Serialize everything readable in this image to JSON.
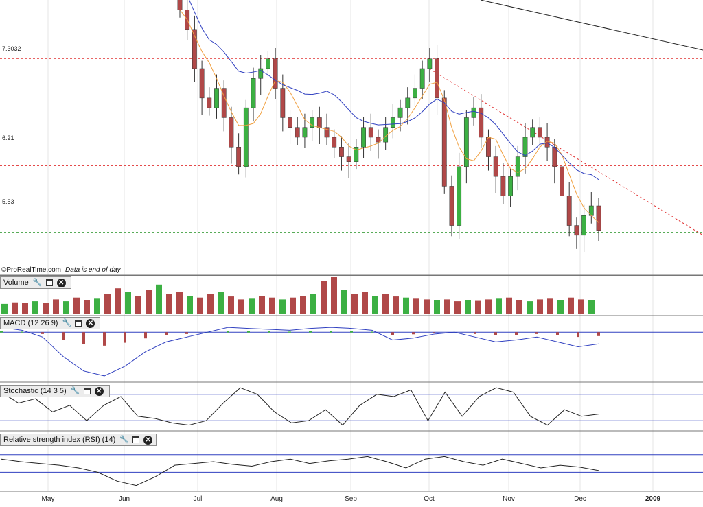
{
  "watermark": {
    "brand": "©ProRealTime.com",
    "note": "Data is end of day"
  },
  "panels": {
    "volume": {
      "label": "Volume"
    },
    "macd": {
      "label": "MACD (12 26 9)"
    },
    "stochastic": {
      "label": "Stochastic (14 3 5)"
    },
    "rsi": {
      "label": "Relative strength index (RSI) (14)"
    }
  },
  "price_levels": [
    {
      "label": "7.3032",
      "value": 7.3032,
      "color": "#e03030",
      "style": "dashed"
    },
    {
      "label": "6.21",
      "value": 6.21,
      "color": "#e03030",
      "style": "dashed"
    },
    {
      "label": "5.53",
      "value": 5.53,
      "color": "#40a040",
      "style": "dashed"
    }
  ],
  "x_axis": {
    "months": [
      "May",
      "Jun",
      "Jul",
      "Aug",
      "Sep",
      "Oct",
      "Nov",
      "Dec"
    ],
    "year_label": "2009"
  },
  "colors": {
    "up_candle": "#3cb043",
    "down_candle": "#b04848",
    "ma_fast": "#f0a040",
    "ma_slow": "#3040c0",
    "grid": "#e4e4e4"
  },
  "chart_data": [
    {
      "type": "candlestick",
      "title": "",
      "ylim": [
        5.1,
        7.9
      ],
      "series": [
        {
          "name": "price",
          "close_approx": [
            7.8,
            7.6,
            7.2,
            6.9,
            6.8,
            7.0,
            6.7,
            6.4,
            6.2,
            6.8,
            7.1,
            7.2,
            7.3,
            7.0,
            6.7,
            6.6,
            6.5,
            6.6,
            6.7,
            6.6,
            6.5,
            6.4,
            6.3,
            6.25,
            6.4,
            6.6,
            6.5,
            6.45,
            6.6,
            6.7,
            6.8,
            6.9,
            7.0,
            7.2,
            7.3,
            6.9,
            6.0,
            5.6,
            6.2,
            6.7,
            6.8,
            6.5,
            6.3,
            6.1,
            5.9,
            6.1,
            6.3,
            6.5,
            6.6,
            6.5,
            6.4,
            6.2,
            5.9,
            5.6,
            5.5,
            5.7,
            5.8,
            5.55
          ]
        }
      ],
      "horizontal_levels": [
        7.3032,
        6.21,
        5.53
      ]
    },
    {
      "type": "bar",
      "title": "Volume",
      "series": [
        {
          "name": "volume_relative",
          "values": [
            0.28,
            0.32,
            0.3,
            0.35,
            0.3,
            0.4,
            0.35,
            0.45,
            0.38,
            0.42,
            0.55,
            0.7,
            0.6,
            0.5,
            0.65,
            0.8,
            0.55,
            0.6,
            0.5,
            0.45,
            0.55,
            0.6,
            0.48,
            0.4,
            0.42,
            0.5,
            0.45,
            0.4,
            0.45,
            0.5,
            0.55,
            0.9,
            1.0,
            0.65,
            0.55,
            0.6,
            0.5,
            0.55,
            0.48,
            0.45,
            0.42,
            0.4,
            0.38,
            0.4,
            0.35,
            0.38,
            0.36,
            0.4,
            0.42,
            0.45,
            0.38,
            0.35,
            0.4,
            0.42,
            0.38,
            0.45,
            0.4,
            0.38
          ]
        }
      ]
    },
    {
      "type": "line",
      "title": "MACD (12 26 9)",
      "series": [
        {
          "name": "macd",
          "values": [
            0.05,
            0.02,
            -0.05,
            -0.25,
            -0.4,
            -0.45,
            -0.35,
            -0.2,
            -0.1,
            -0.05,
            0.0,
            0.05,
            0.04,
            0.03,
            0.02,
            0.04,
            0.05,
            0.04,
            0.02,
            -0.08,
            -0.06,
            -0.02,
            0.0,
            -0.05,
            -0.1,
            -0.08,
            -0.05,
            -0.1,
            -0.15,
            -0.12
          ]
        }
      ]
    },
    {
      "type": "line",
      "title": "Stochastic (14 3 5)",
      "series": [
        {
          "name": "%K",
          "values": [
            85,
            60,
            70,
            40,
            55,
            20,
            55,
            75,
            30,
            25,
            15,
            10,
            20,
            60,
            95,
            80,
            40,
            15,
            20,
            45,
            10,
            55,
            80,
            75,
            90,
            20,
            85,
            30,
            75,
            95,
            85,
            30,
            10,
            45,
            30,
            35
          ]
        }
      ]
    },
    {
      "type": "line",
      "title": "Relative strength index (RSI) (14)",
      "series": [
        {
          "name": "rsi",
          "values": [
            55,
            52,
            50,
            48,
            45,
            40,
            30,
            25,
            35,
            48,
            50,
            52,
            49,
            47,
            52,
            55,
            50,
            53,
            55,
            58,
            52,
            45,
            55,
            58,
            52,
            48,
            55,
            50,
            45,
            48,
            46,
            42
          ]
        }
      ]
    }
  ]
}
